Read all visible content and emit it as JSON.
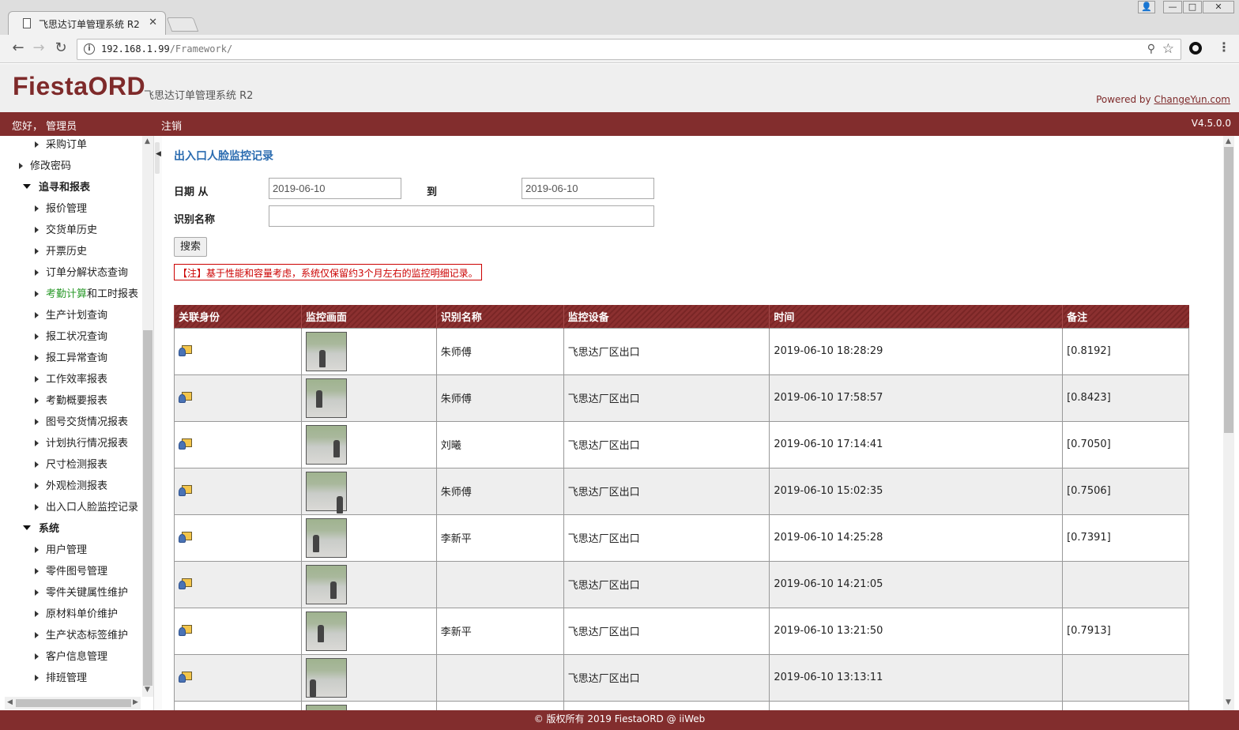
{
  "browser": {
    "tab_title": "飞思达订单管理系统 R2",
    "tab_close": "✕",
    "url_host": "192.168.1.99",
    "url_path": "/Framework/",
    "back": "←",
    "forward": "→",
    "reload": "↻",
    "info": "i",
    "pin": "⚲",
    "star": "☆",
    "menu": "⋮",
    "win_user": "👤",
    "win_min": "—",
    "win_max": "□",
    "win_close": "✕"
  },
  "header": {
    "logo": "FiestaORD",
    "subtitle": "飞思达订单管理系统 R2",
    "powered_prefix": "Powered by ",
    "powered_link": "ChangeYun.com",
    "greeting": "您好， 管理员",
    "logout": "注销",
    "version": "V4.5.0.0"
  },
  "sidebar": {
    "items": [
      {
        "label": "采购订单",
        "level": 2
      },
      {
        "label": "修改密码",
        "level": 1
      },
      {
        "label": "追寻和报表",
        "level": 0
      },
      {
        "label": "报价管理",
        "level": 2
      },
      {
        "label": "交货单历史",
        "level": 2
      },
      {
        "label": "开票历史",
        "level": 2
      },
      {
        "label": "订单分解状态查询",
        "level": 2
      },
      {
        "label_green": "考勤计算",
        "label_rest": "和工时报表",
        "level": 2
      },
      {
        "label": "生产计划查询",
        "level": 2
      },
      {
        "label": "报工状况查询",
        "level": 2
      },
      {
        "label": "报工异常查询",
        "level": 2
      },
      {
        "label": "工作效率报表",
        "level": 2
      },
      {
        "label": "考勤概要报表",
        "level": 2
      },
      {
        "label": "图号交货情况报表",
        "level": 2
      },
      {
        "label": "计划执行情况报表",
        "level": 2
      },
      {
        "label": "尺寸检测报表",
        "level": 2
      },
      {
        "label": "外观检测报表",
        "level": 2
      },
      {
        "label": "出入口人脸监控记录",
        "level": 2
      },
      {
        "label": "系统",
        "level": 0
      },
      {
        "label": "用户管理",
        "level": 2
      },
      {
        "label": "零件图号管理",
        "level": 2
      },
      {
        "label": "零件关键属性维护",
        "level": 2
      },
      {
        "label": "原材料单价维护",
        "level": 2
      },
      {
        "label": "生产状态标签维护",
        "level": 2
      },
      {
        "label": "客户信息管理",
        "level": 2
      },
      {
        "label": "排班管理",
        "level": 2
      }
    ]
  },
  "main": {
    "title": "出入口人脸监控记录",
    "date_from_label": "日期 从",
    "date_from": "2019-06-10",
    "date_to_label": "到",
    "date_to": "2019-06-10",
    "name_label": "识别名称",
    "name_value": "",
    "search_button": "搜索",
    "note": "【注】基于性能和容量考虑，系统仅保留约3个月左右的监控明细记录。",
    "columns": [
      "关联身份",
      "监控画面",
      "识别名称",
      "监控设备",
      "时间",
      "备注"
    ],
    "rows": [
      {
        "name": "朱师傅",
        "device": "飞思达厂区出口",
        "time": "2019-06-10 18:28:29",
        "remark": "[0.8192]"
      },
      {
        "name": "朱师傅",
        "device": "飞思达厂区出口",
        "time": "2019-06-10 17:58:57",
        "remark": "[0.8423]"
      },
      {
        "name": "刘曦",
        "device": "飞思达厂区出口",
        "time": "2019-06-10 17:14:41",
        "remark": "[0.7050]"
      },
      {
        "name": "朱师傅",
        "device": "飞思达厂区出口",
        "time": "2019-06-10 15:02:35",
        "remark": "[0.7506]"
      },
      {
        "name": "李新平",
        "device": "飞思达厂区出口",
        "time": "2019-06-10 14:25:28",
        "remark": "[0.7391]"
      },
      {
        "name": "",
        "device": "飞思达厂区出口",
        "time": "2019-06-10 14:21:05",
        "remark": ""
      },
      {
        "name": "李新平",
        "device": "飞思达厂区出口",
        "time": "2019-06-10 13:21:50",
        "remark": "[0.7913]"
      },
      {
        "name": "",
        "device": "飞思达厂区出口",
        "time": "2019-06-10 13:13:11",
        "remark": ""
      },
      {
        "name": "",
        "device": "",
        "time": "",
        "remark": ""
      }
    ]
  },
  "footer": "© 版权所有 2019 FiestaORD @ iiWeb",
  "colors": {
    "brand": "#822d2d",
    "title_blue": "#2b6cb0",
    "note_red": "#cc0000",
    "green_text": "#2a9a2a"
  }
}
